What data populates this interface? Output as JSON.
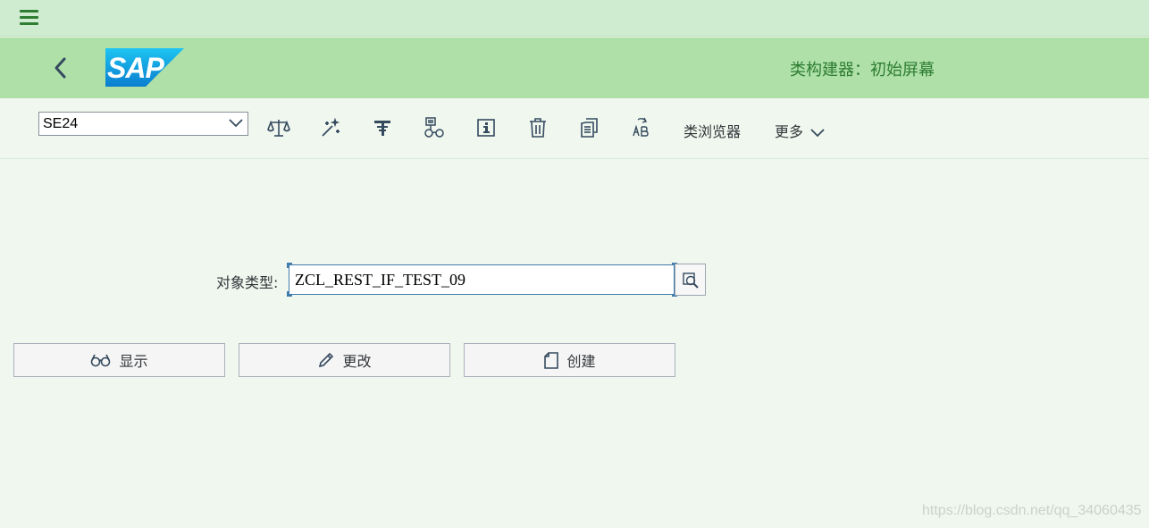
{
  "header": {
    "title": "类构建器：初始屏幕",
    "logo_text": "SAP"
  },
  "toolbar": {
    "command_value": "SE24",
    "class_browser_label": "类浏览器",
    "more_label": "更多"
  },
  "form": {
    "object_type_label": "对象类型:",
    "object_type_value": "ZCL_REST_IF_TEST_09"
  },
  "actions": {
    "display_label": "显示",
    "change_label": "更改",
    "create_label": "创建"
  },
  "watermark": "https://blog.csdn.net/qq_34060435",
  "colors": {
    "topbar": "#d0ecd0",
    "header": "#aee0a8",
    "body": "#eff7ee",
    "accent": "#2e7d32",
    "icon": "#354a5f"
  }
}
